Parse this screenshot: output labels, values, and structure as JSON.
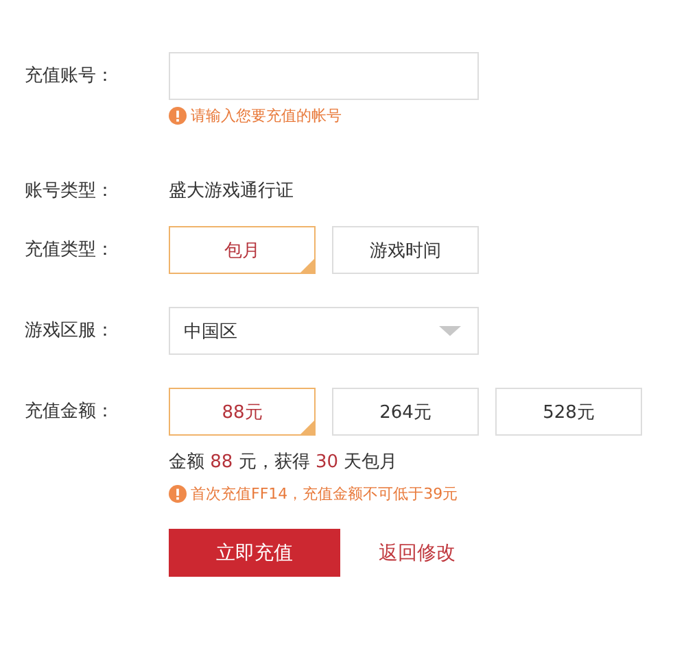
{
  "account": {
    "label": "充值账号：",
    "hint": "请输入您要充值的帐号"
  },
  "account_type": {
    "label": "账号类型：",
    "value": "盛大游戏通行证"
  },
  "recharge_type": {
    "label": "充值类型：",
    "options": [
      {
        "label": "包月",
        "selected": true
      },
      {
        "label": "游戏时间",
        "selected": false
      }
    ]
  },
  "region": {
    "label": "游戏区服：",
    "value": "中国区"
  },
  "amount": {
    "label": "充值金额：",
    "options": [
      {
        "label": "88元",
        "selected": true
      },
      {
        "label": "264元",
        "selected": false
      },
      {
        "label": "528元",
        "selected": false
      }
    ]
  },
  "summary": [
    {
      "text": "金额 ",
      "highlight": false
    },
    {
      "text": "88",
      "highlight": true
    },
    {
      "text": " 元，获得 ",
      "highlight": false
    },
    {
      "text": "30",
      "highlight": true
    },
    {
      "text": " 天包月",
      "highlight": false
    }
  ],
  "warning": "首次充值FF14，充值金额不可低于39元",
  "submit_button": "立即充值",
  "back_link": "返回修改"
}
